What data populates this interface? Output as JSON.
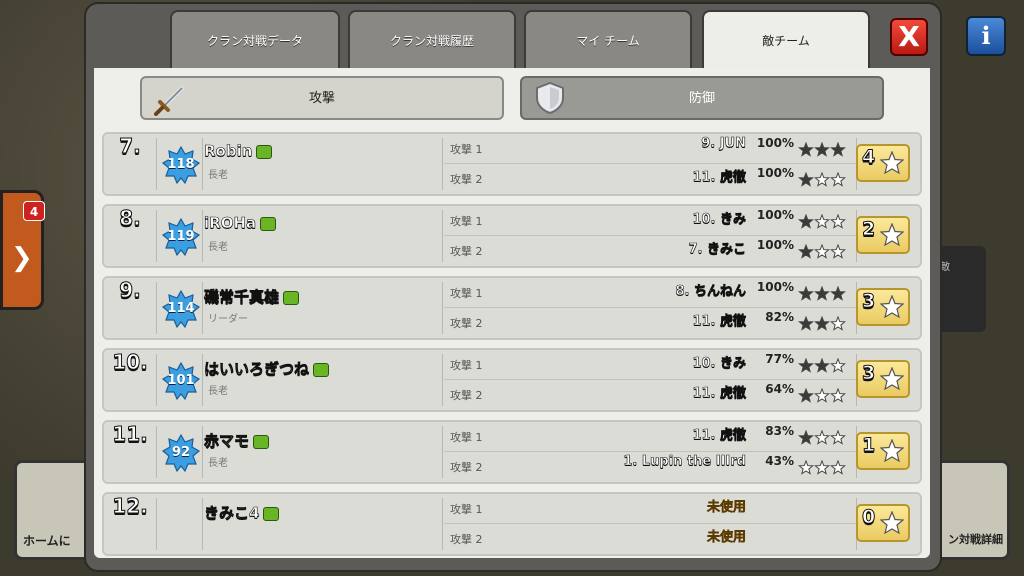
{
  "background": {
    "side_badge": "4",
    "home_label": "ホームに",
    "right_card_label": "敵",
    "detail_label": "ン対戦詳細"
  },
  "tabs": [
    {
      "label": "クラン対戦データ",
      "active": false
    },
    {
      "label": "クラン対戦履歴",
      "active": false
    },
    {
      "label": "マイ チーム",
      "active": false
    },
    {
      "label": "敵チーム",
      "active": true
    }
  ],
  "close_label": "X",
  "info_label": "i",
  "toggle": {
    "attack": "攻撃",
    "defense": "防御"
  },
  "colors": {
    "star_filled": "#3a3a3a",
    "star_empty": "#ffffff",
    "level_badge": "#3a9ee0",
    "chat_icon": "#6ab526"
  },
  "players": [
    {
      "rank": "7.",
      "level": "118",
      "name": "Robin",
      "role": "長老",
      "total": "4",
      "attacks": [
        {
          "label": "攻撃 1",
          "target": "9. JUN",
          "percent": "100%",
          "stars": 3,
          "used": true
        },
        {
          "label": "攻撃 2",
          "target": "11. 虎徹",
          "percent": "100%",
          "stars": 1,
          "used": true
        }
      ]
    },
    {
      "rank": "8.",
      "level": "119",
      "name": "iROHa",
      "role": "長老",
      "total": "2",
      "attacks": [
        {
          "label": "攻撃 1",
          "target": "10. きみ",
          "percent": "100%",
          "stars": 1,
          "used": true
        },
        {
          "label": "攻撃 2",
          "target": "7. きみこ",
          "percent": "100%",
          "stars": 1,
          "used": true
        }
      ]
    },
    {
      "rank": "9.",
      "level": "114",
      "name": "磯常千真雄",
      "role": "リーダー",
      "total": "3",
      "attacks": [
        {
          "label": "攻撃 1",
          "target": "8. ちんねん",
          "percent": "100%",
          "stars": 3,
          "used": true
        },
        {
          "label": "攻撃 2",
          "target": "11. 虎徹",
          "percent": "82%",
          "stars": 2,
          "used": true
        }
      ]
    },
    {
      "rank": "10.",
      "level": "101",
      "name": "はいいろぎつね",
      "role": "長老",
      "total": "3",
      "attacks": [
        {
          "label": "攻撃 1",
          "target": "10. きみ",
          "percent": "77%",
          "stars": 2,
          "used": true
        },
        {
          "label": "攻撃 2",
          "target": "11. 虎徹",
          "percent": "64%",
          "stars": 1,
          "used": true
        }
      ]
    },
    {
      "rank": "11.",
      "level": "92",
      "name": "赤マモ",
      "role": "長老",
      "total": "1",
      "attacks": [
        {
          "label": "攻撃 1",
          "target": "11. 虎徹",
          "percent": "83%",
          "stars": 1,
          "used": true
        },
        {
          "label": "攻撃 2",
          "target": "1. Lupin the IIIrd",
          "percent": "43%",
          "stars": 0,
          "used": true
        }
      ]
    },
    {
      "rank": "12.",
      "level": "",
      "name": "きみこ4",
      "role": "",
      "total": "0",
      "attacks": [
        {
          "label": "攻撃 1",
          "target": "未使用",
          "percent": "",
          "stars": -1,
          "used": false
        },
        {
          "label": "攻撃 2",
          "target": "未使用",
          "percent": "",
          "stars": -1,
          "used": false
        }
      ]
    }
  ]
}
